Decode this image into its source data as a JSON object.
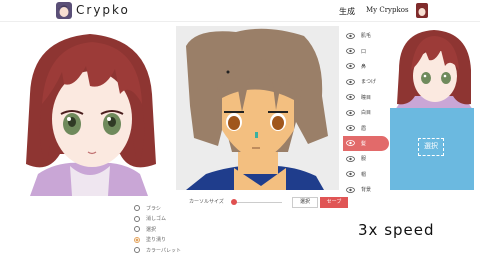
{
  "header": {
    "brand": "Crypko",
    "nav_generate": "生成",
    "nav_mycrypkos": "My Crypkos"
  },
  "palette": {
    "items": [
      {
        "label": "肌毛",
        "active": false
      },
      {
        "label": "口",
        "active": false
      },
      {
        "label": "鼻",
        "active": false
      },
      {
        "label": "まつげ",
        "active": false
      },
      {
        "label": "瞳目",
        "active": false
      },
      {
        "label": "白目",
        "active": false
      },
      {
        "label": "眉",
        "active": false
      },
      {
        "label": "髪",
        "active": true
      },
      {
        "label": "服",
        "active": false
      },
      {
        "label": "帽",
        "active": false
      },
      {
        "label": "背景",
        "active": false
      }
    ]
  },
  "select_box": {
    "label": "選択"
  },
  "tools": {
    "radios": [
      {
        "label": "ブラシ",
        "checked": false
      },
      {
        "label": "消しゴム",
        "checked": false
      },
      {
        "label": "選択",
        "checked": false
      },
      {
        "label": "塗り潰り",
        "checked": true
      },
      {
        "label": "カラーパレット",
        "checked": false
      }
    ],
    "size_label": "カーソルサイズ",
    "select_button": "選択",
    "save_button": "セーブ"
  },
  "overlay": {
    "speed": "3x speed"
  },
  "colors": {
    "hair_red": "#8e3532",
    "sketch_hair": "#9a7f68",
    "accent": "#e05555",
    "select_blue": "#6bb9e0"
  }
}
